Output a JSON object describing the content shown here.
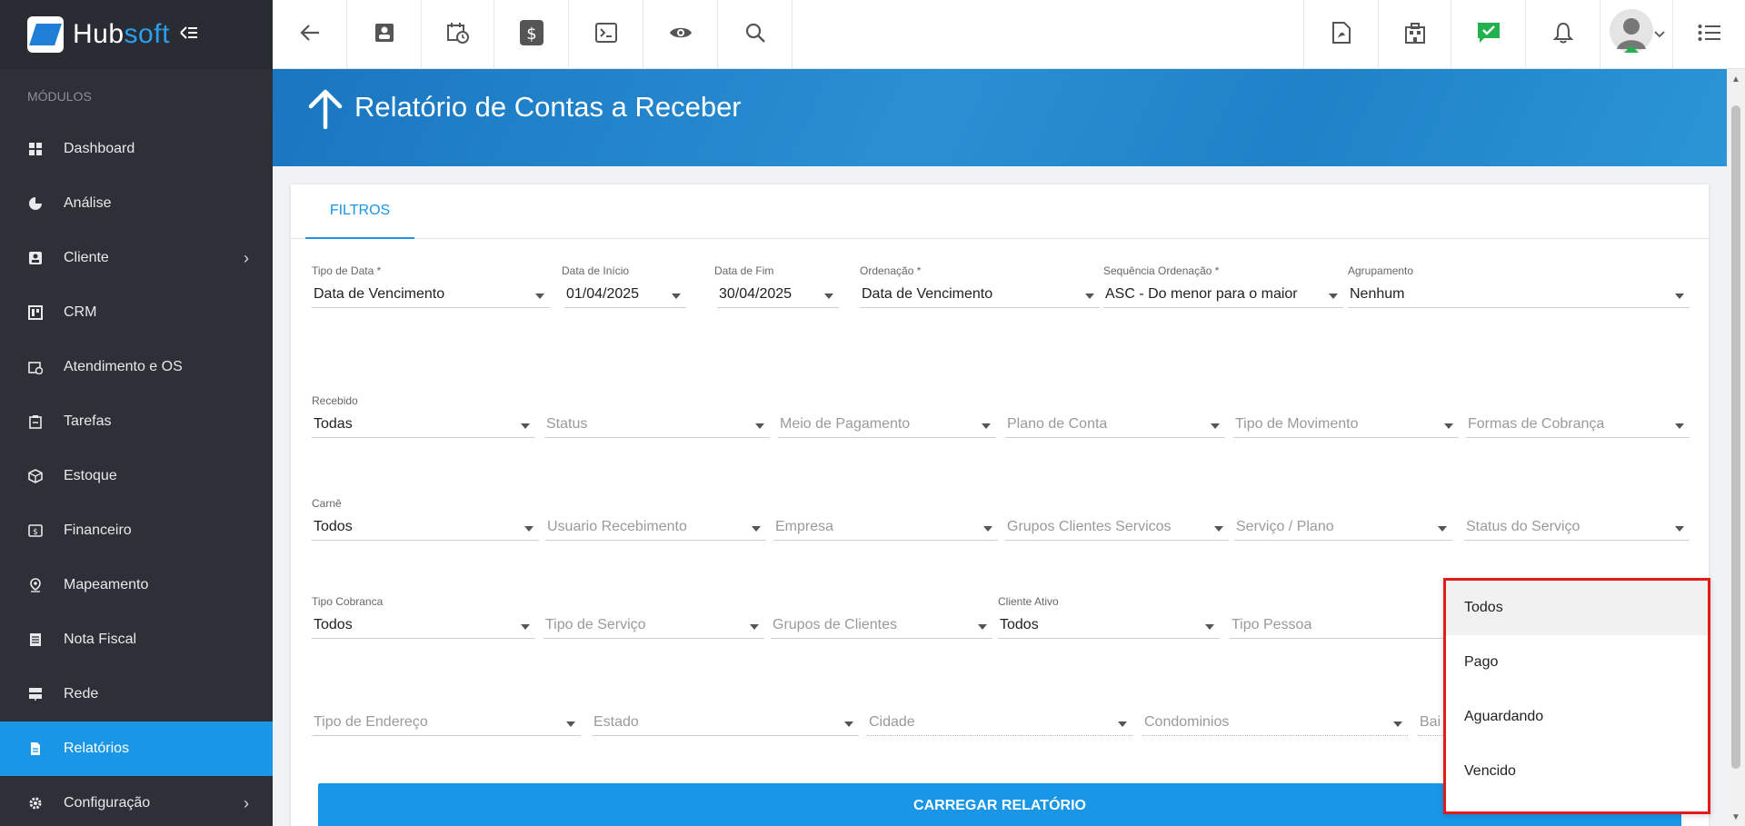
{
  "brand": {
    "name_part1": "Hub",
    "name_part2": "soft"
  },
  "sidebar": {
    "section_label": "MÓDULOS",
    "items": [
      {
        "label": "Dashboard",
        "icon": "dashboard-icon"
      },
      {
        "label": "Análise",
        "icon": "pie-chart-icon"
      },
      {
        "label": "Cliente",
        "icon": "contact-card-icon",
        "has_submenu": true
      },
      {
        "label": "CRM",
        "icon": "crm-board-icon"
      },
      {
        "label": "Atendimento e OS",
        "icon": "calendar-clock-icon"
      },
      {
        "label": "Tarefas",
        "icon": "task-clipboard-icon"
      },
      {
        "label": "Estoque",
        "icon": "box-icon"
      },
      {
        "label": "Financeiro",
        "icon": "money-icon"
      },
      {
        "label": "Mapeamento",
        "icon": "map-pin-icon"
      },
      {
        "label": "Nota Fiscal",
        "icon": "invoice-icon"
      },
      {
        "label": "Rede",
        "icon": "server-icon"
      },
      {
        "label": "Relatórios",
        "icon": "report-icon",
        "active": true
      },
      {
        "label": "Configuração",
        "icon": "gear-icon",
        "has_submenu": true
      }
    ]
  },
  "page": {
    "title": "Relatório de Contas a Receber"
  },
  "tabs": {
    "filtros": "FILTROS"
  },
  "filters": {
    "tipo_data": {
      "label": "Tipo de Data *",
      "value": "Data de Vencimento"
    },
    "data_inicio": {
      "label": "Data de Início",
      "value": "01/04/2025"
    },
    "data_fim": {
      "label": "Data de Fim",
      "value": "30/04/2025"
    },
    "ordenacao": {
      "label": "Ordenação *",
      "value": "Data de Vencimento"
    },
    "sequencia": {
      "label": "Sequência Ordenação *",
      "value": "ASC - Do menor para o maior"
    },
    "agrupamento": {
      "label": "Agrupamento",
      "value": "Nenhum"
    },
    "recebido": {
      "label": "Recebido",
      "value": "Todas"
    },
    "status": {
      "placeholder": "Status"
    },
    "meio_pagamento": {
      "placeholder": "Meio de Pagamento"
    },
    "plano_conta": {
      "placeholder": "Plano de Conta"
    },
    "tipo_movimento": {
      "placeholder": "Tipo de Movimento"
    },
    "formas_cobranca": {
      "placeholder": "Formas de Cobrança"
    },
    "carne": {
      "label": "Carnê",
      "value": "Todos"
    },
    "usuario_recebimento": {
      "placeholder": "Usuario Recebimento"
    },
    "empresa": {
      "placeholder": "Empresa"
    },
    "grupos_clientes_servicos": {
      "placeholder": "Grupos Clientes Servicos"
    },
    "servico_plano": {
      "placeholder": "Serviço / Plano"
    },
    "status_servico": {
      "placeholder": "Status do Serviço"
    },
    "tipo_cobranca": {
      "label": "Tipo Cobranca",
      "value": "Todos"
    },
    "tipo_servico": {
      "placeholder": "Tipo de Serviço"
    },
    "grupos_clientes": {
      "placeholder": "Grupos de Clientes"
    },
    "cliente_ativo": {
      "label": "Cliente Ativo",
      "value": "Todos"
    },
    "tipo_pessoa": {
      "placeholder": "Tipo Pessoa"
    },
    "tipo_endereco": {
      "placeholder": "Tipo de Endereço"
    },
    "estado": {
      "placeholder": "Estado"
    },
    "cidade": {
      "placeholder": "Cidade"
    },
    "condominios": {
      "placeholder": "Condominios"
    },
    "bairro": {
      "placeholder": "Bai"
    }
  },
  "actions": {
    "load_report": "CARREGAR RELATÓRIO"
  },
  "dropdown": {
    "options": [
      "Todos",
      "Pago",
      "Aguardando",
      "Vencido"
    ],
    "highlighted_index": 0
  },
  "colors": {
    "primary": "#1a96e6",
    "sidebar_bg": "#2e3038",
    "highlight_border": "#e21b1b",
    "check_badge": "#22b14c"
  }
}
